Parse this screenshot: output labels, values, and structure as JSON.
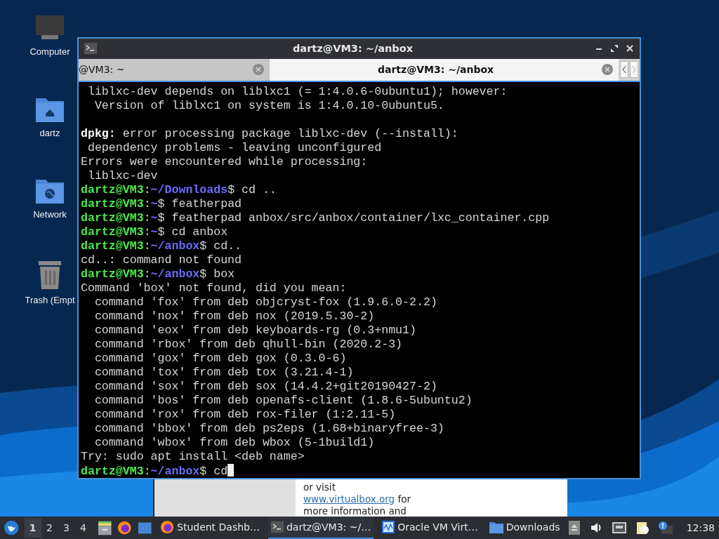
{
  "desktop_icons": [
    {
      "label": "Computer",
      "kind": "computer"
    },
    {
      "label": "dartz",
      "kind": "home"
    },
    {
      "label": "Network",
      "kind": "network"
    },
    {
      "label": "Trash (Empt",
      "kind": "trash"
    }
  ],
  "background_window": {
    "lines": [
      {
        "text": "or visit"
      },
      {
        "link": "www.virtualbox.org",
        "text": " for"
      },
      {
        "text": "more information and"
      }
    ]
  },
  "terminal": {
    "title": "dartz@VM3: ~/anbox",
    "tabs": [
      {
        "label": "@VM3: ~",
        "selected": false
      },
      {
        "label": "dartz@VM3: ~/anbox",
        "selected": true
      }
    ],
    "lines": [
      {
        "kind": "output",
        "text": " liblxc-dev depends on liblxc1 (= 1:4.0.6-0ubuntu1); however:"
      },
      {
        "kind": "output",
        "text": "  Version of liblxc1 on system is 1:4.0.10-0ubuntu5."
      },
      {
        "kind": "blank"
      },
      {
        "kind": "output",
        "text": "**dpkg:** error processing package liblxc-dev (--install):"
      },
      {
        "kind": "output",
        "text": " dependency problems - leaving unconfigured"
      },
      {
        "kind": "output",
        "text": "Errors were encountered while processing:"
      },
      {
        "kind": "output",
        "text": " liblxc-dev"
      },
      {
        "kind": "prompt",
        "user": "dartz@VM3",
        "sep": ":",
        "path": "~/Downloads",
        "rest": "$ cd .."
      },
      {
        "kind": "prompt",
        "user": "dartz@VM3",
        "sep": ":",
        "path": "~",
        "rest": "$ featherpad"
      },
      {
        "kind": "prompt",
        "user": "dartz@VM3",
        "sep": ":",
        "path": "~",
        "rest": "$ featherpad anbox/src/anbox/container/lxc_container.cpp"
      },
      {
        "kind": "prompt",
        "user": "dartz@VM3",
        "sep": ":",
        "path": "~",
        "rest": "$ cd anbox"
      },
      {
        "kind": "prompt",
        "user": "dartz@VM3",
        "sep": ":",
        "path": "~/anbox",
        "rest": "$ cd.."
      },
      {
        "kind": "output",
        "text": "cd..: command not found"
      },
      {
        "kind": "prompt",
        "user": "dartz@VM3",
        "sep": ":",
        "path": "~/anbox",
        "rest": "$ box"
      },
      {
        "kind": "output",
        "text": "Command 'box' not found, did you mean:"
      },
      {
        "kind": "output",
        "text": "  command 'fox' from deb objcryst-fox (1.9.6.0-2.2)"
      },
      {
        "kind": "output",
        "text": "  command 'nox' from deb nox (2019.5.30-2)"
      },
      {
        "kind": "output",
        "text": "  command 'eox' from deb keyboards-rg (0.3+nmu1)"
      },
      {
        "kind": "output",
        "text": "  command 'rbox' from deb qhull-bin (2020.2-3)"
      },
      {
        "kind": "output",
        "text": "  command 'gox' from deb gox (0.3.0-6)"
      },
      {
        "kind": "output",
        "text": "  command 'tox' from deb tox (3.21.4-1)"
      },
      {
        "kind": "output",
        "text": "  command 'sox' from deb sox (14.4.2+git20190427-2)"
      },
      {
        "kind": "output",
        "text": "  command 'bos' from deb openafs-client (1.8.6-5ubuntu2)"
      },
      {
        "kind": "output",
        "text": "  command 'rox' from deb rox-filer (1:2.11-5)"
      },
      {
        "kind": "output",
        "text": "  command 'bbox' from deb ps2eps (1.68+binaryfree-3)"
      },
      {
        "kind": "output",
        "text": "  command 'wbox' from deb wbox (5-1build1)"
      },
      {
        "kind": "output",
        "text": "Try: sudo apt install <deb name>"
      },
      {
        "kind": "prompt",
        "user": "dartz@VM3",
        "sep": ":",
        "path": "~/anbox",
        "rest": "$ cd",
        "cursor": true
      }
    ]
  },
  "taskbar": {
    "workspaces": [
      {
        "label": "1",
        "selected": true
      },
      {
        "label": "2",
        "selected": false
      },
      {
        "label": "3",
        "selected": false
      },
      {
        "label": "4",
        "selected": false
      }
    ],
    "tasks": [
      {
        "label": "Student Dashb…",
        "kind": "firefox",
        "selected": false
      },
      {
        "label": "dartz@VM3: ~/…",
        "kind": "terminal",
        "selected": true
      },
      {
        "label": "Oracle VM Virt…",
        "kind": "virtualbox",
        "selected": false
      },
      {
        "label": "Downloads",
        "kind": "folder",
        "selected": false
      }
    ],
    "clock": "12:38"
  }
}
